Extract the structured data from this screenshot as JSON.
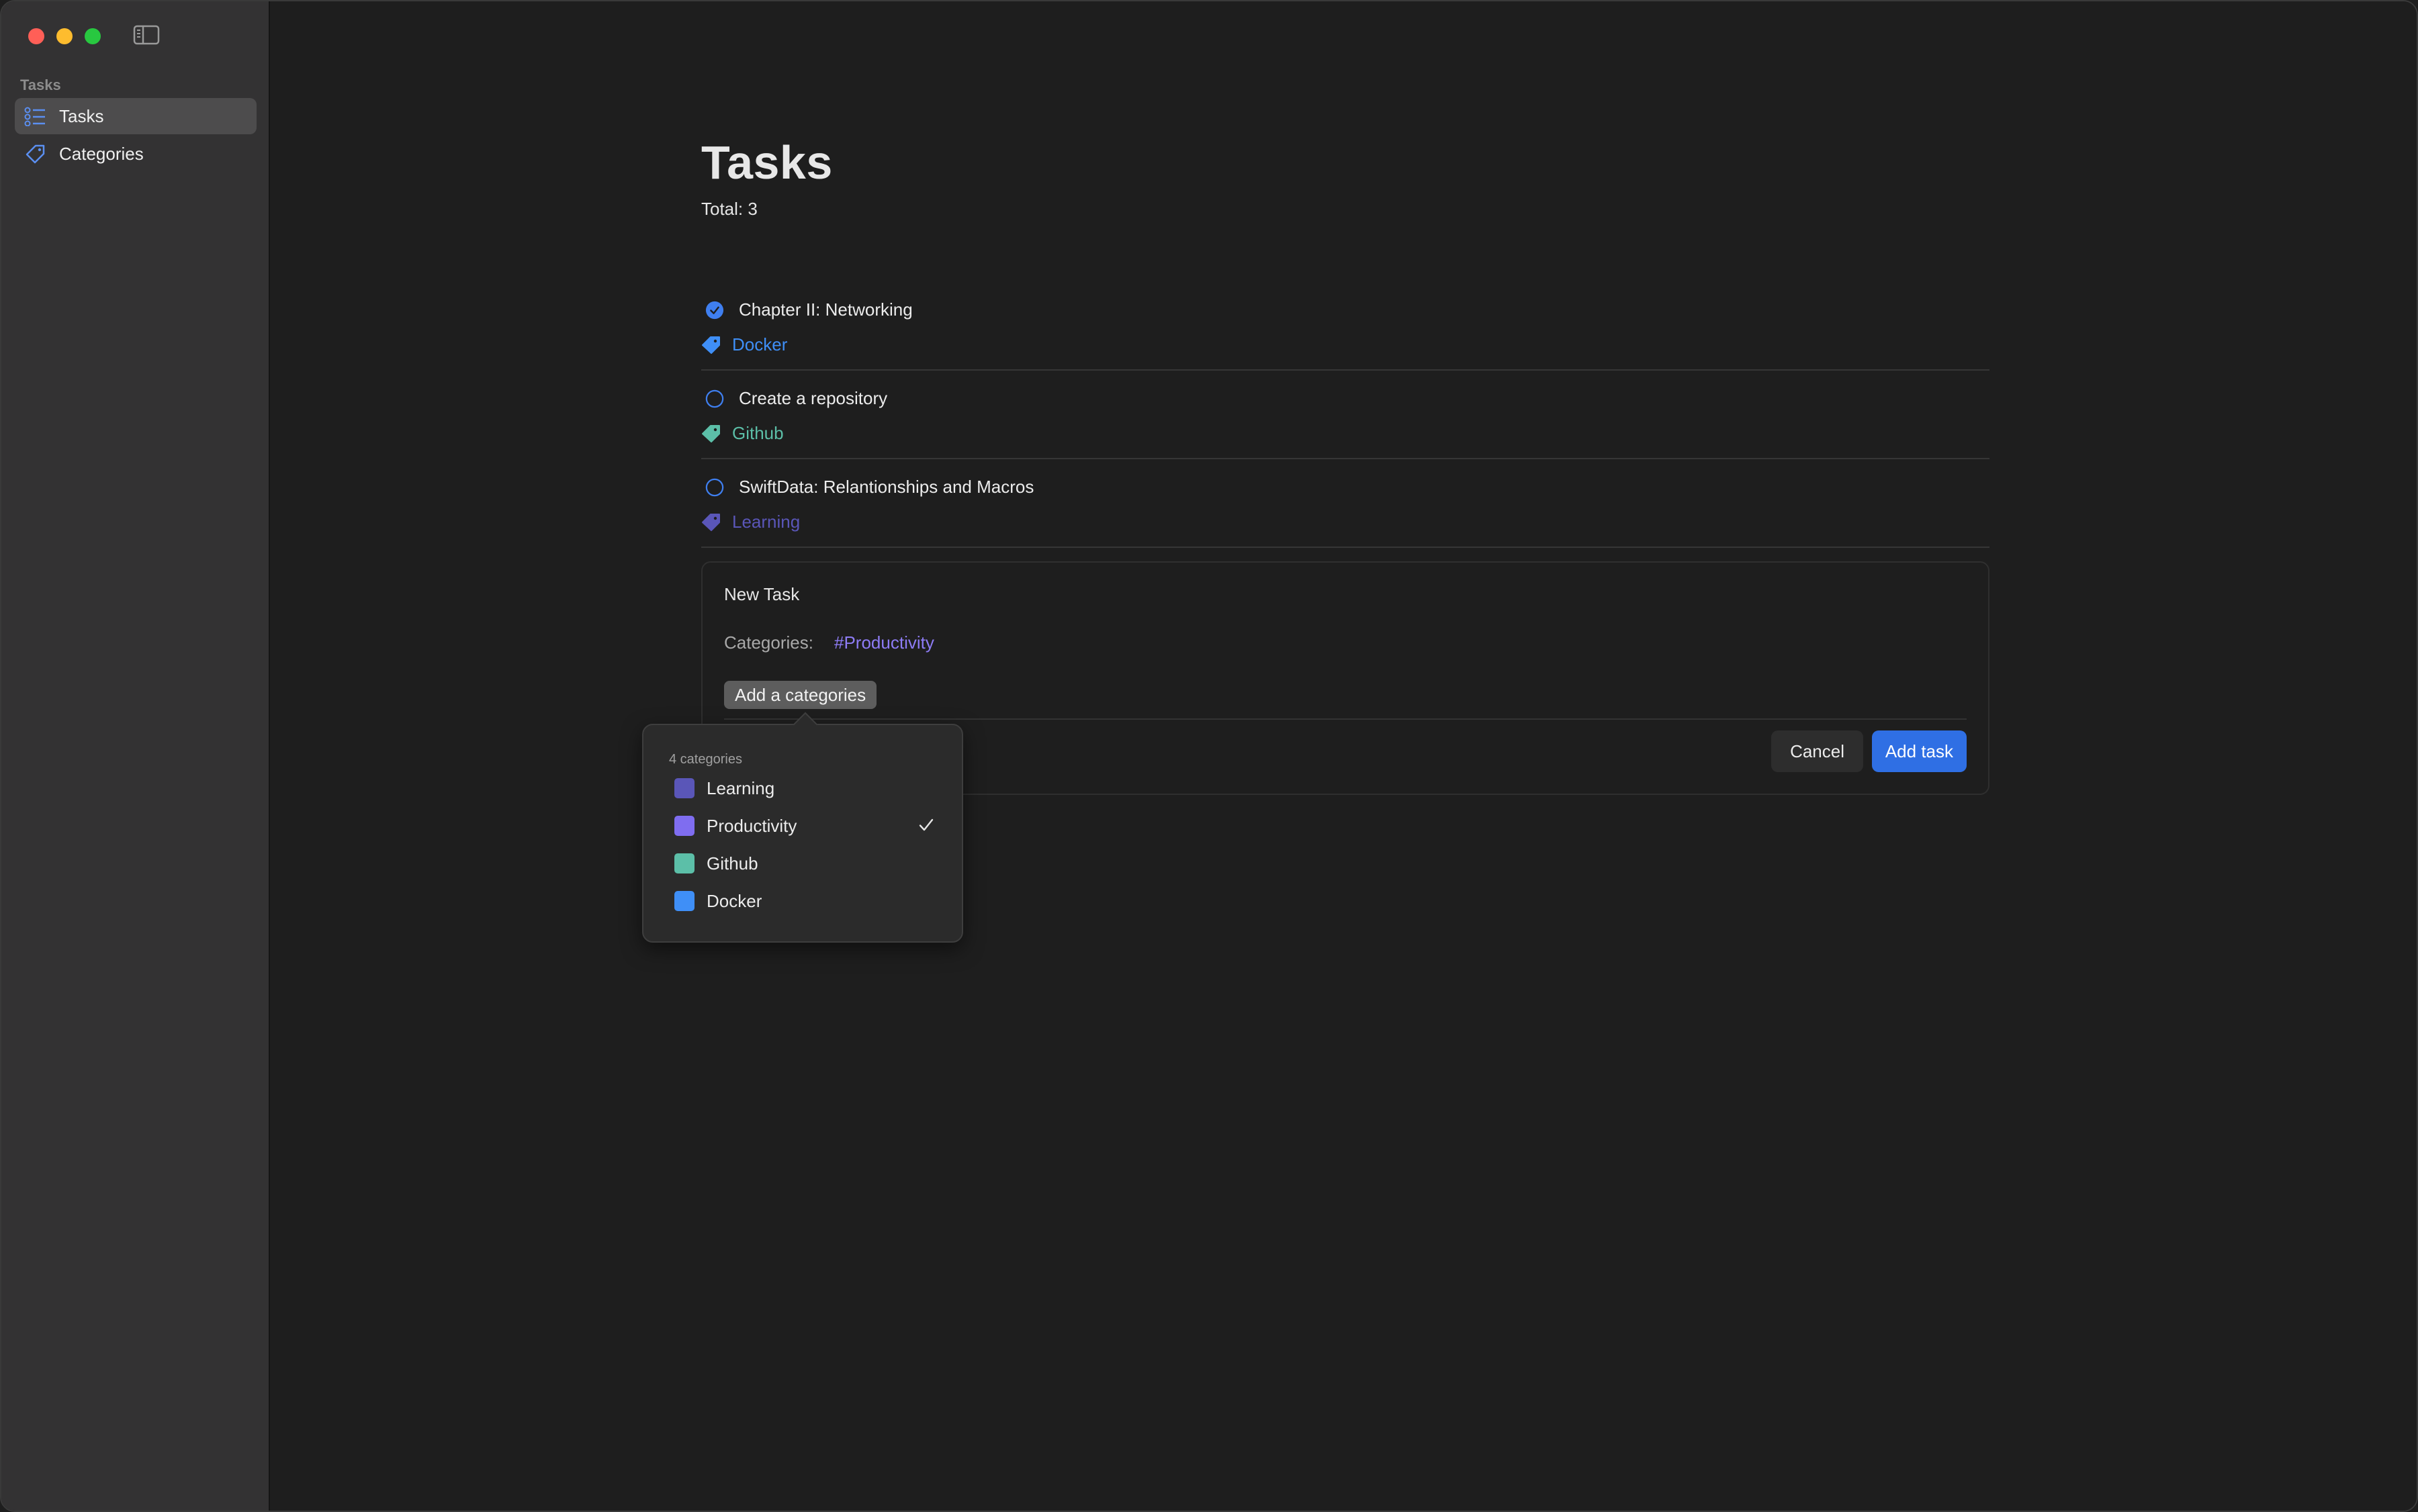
{
  "colors": {
    "accent": "#2f6fe4",
    "learning": "#5a56b8",
    "productivity": "#7f6df0",
    "github": "#5cbfa8",
    "docker": "#3f8ff7"
  },
  "sidebar": {
    "section_title": "Tasks",
    "items": [
      {
        "label": "Tasks",
        "icon": "checklist-icon",
        "active": true
      },
      {
        "label": "Categories",
        "icon": "tag-icon",
        "active": false
      }
    ]
  },
  "main": {
    "title": "Tasks",
    "total": "Total: 3",
    "tasks": [
      {
        "title": "Chapter II: Networking",
        "done": true,
        "category": "Docker",
        "category_color": "#3f8ff7"
      },
      {
        "title": "Create a repository",
        "done": false,
        "category": "Github",
        "category_color": "#5cbfa8"
      },
      {
        "title": "SwiftData: Relantionships and Macros",
        "done": false,
        "category": "Learning",
        "category_color": "#5a56b8"
      }
    ]
  },
  "new_task": {
    "title": "New Task",
    "categories_label": "Categories:",
    "selected_categories": "#Productivity",
    "add_category_button": "Add a categories",
    "cancel_button": "Cancel",
    "add_task_button": "Add task"
  },
  "category_popover": {
    "count_label": "4 categories",
    "items": [
      {
        "label": "Learning",
        "color": "#5a56b8",
        "checked": false
      },
      {
        "label": "Productivity",
        "color": "#7f6df0",
        "checked": true
      },
      {
        "label": "Github",
        "color": "#5cbfa8",
        "checked": false
      },
      {
        "label": "Docker",
        "color": "#3f8ff7",
        "checked": false
      }
    ]
  }
}
